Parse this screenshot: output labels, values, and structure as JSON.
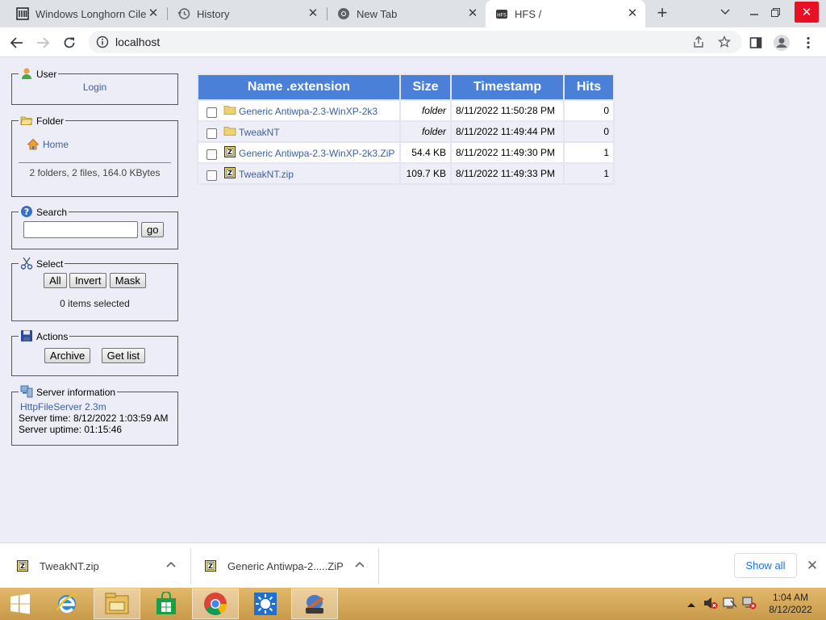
{
  "browser": {
    "tabs": [
      {
        "title": "Windows Longhorn Cilem",
        "icon": "library-icon",
        "active": false
      },
      {
        "title": "History",
        "icon": "history-icon",
        "active": false
      },
      {
        "title": "New Tab",
        "icon": "chrome-icon",
        "active": false
      },
      {
        "title": "HFS /",
        "icon": "hfs-icon",
        "active": true
      }
    ],
    "url": "localhost"
  },
  "panels": {
    "user": {
      "legend": "User",
      "login": "Login"
    },
    "folder": {
      "legend": "Folder",
      "home": "Home",
      "summary": "2 folders, 2 files, 164.0 KBytes"
    },
    "search": {
      "legend": "Search",
      "value": "",
      "go": "go"
    },
    "select": {
      "legend": "Select",
      "all": "All",
      "invert": "Invert",
      "mask": "Mask",
      "status": "0 items selected"
    },
    "actions": {
      "legend": "Actions",
      "archive": "Archive",
      "getlist": "Get list"
    },
    "server": {
      "legend": "Server information",
      "link": "HttpFileServer 2.3m",
      "time": "Server time: 8/12/2022 1:03:59 AM",
      "uptime": "Server uptime: 01:15:46"
    }
  },
  "table": {
    "headers": [
      "Name .extension",
      "Size",
      "Timestamp",
      "Hits"
    ],
    "rows": [
      {
        "name": "Generic Antiwpa-2.3-WinXP-2k3",
        "type": "folder",
        "size": "folder",
        "timestamp": "8/11/2022 11:50:28 PM",
        "hits": "0"
      },
      {
        "name": "TweakNT",
        "type": "folder",
        "size": "folder",
        "timestamp": "8/11/2022 11:49:44 PM",
        "hits": "0"
      },
      {
        "name": "Generic Antiwpa-2.3-WinXP-2k3.ZiP",
        "type": "zip",
        "size": "54.4 KB",
        "timestamp": "8/11/2022 11:49:30 PM",
        "hits": "1"
      },
      {
        "name": "TweakNT.zip",
        "type": "zip",
        "size": "109.7 KB",
        "timestamp": "8/11/2022 11:49:33 PM",
        "hits": "1"
      }
    ]
  },
  "downloads": {
    "items": [
      {
        "name": "TweakNT.zip"
      },
      {
        "name": "Generic Antiwpa-2.....ZiP"
      }
    ],
    "show_all": "Show all"
  },
  "taskbar": {
    "time": "1:04 AM",
    "date": "8/12/2022"
  },
  "colors": {
    "header_blue": "#4A80D8",
    "link_blue": "#3D5FA0",
    "page_bg": "#EDEDF8",
    "taskbar": "#D8AE5E"
  }
}
